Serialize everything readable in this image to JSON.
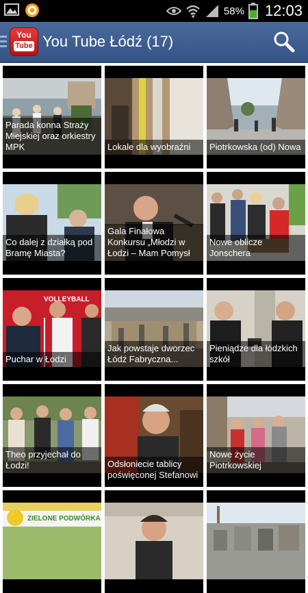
{
  "status_bar": {
    "battery_percent": "58%",
    "time": "12:03",
    "icons": [
      "image-icon",
      "app-notification-icon",
      "eye-icon",
      "wifi-icon",
      "signal-icon",
      "battery-icon"
    ]
  },
  "action_bar": {
    "app_logo_top": "You",
    "app_logo_bottom": "Tube",
    "title": "You Tube Łódź (17)",
    "search_icon": "search-icon"
  },
  "videos": [
    {
      "title": "Parada konna Straży Miejskiej oraz orkiestry MPK"
    },
    {
      "title": "Lokale dla wyobraźni"
    },
    {
      "title": "Piotrkowska (od) Nowa"
    },
    {
      "title": "Co dalej z działką pod Bramę Miasta?"
    },
    {
      "title": "Gala Finałowa Konkursu „Młodzi w Łodzi – Mam Pomysł"
    },
    {
      "title": "Nowe oblicze Jonschera"
    },
    {
      "title": "Puchar w Łodzi"
    },
    {
      "title": "Jak powstaje dworzec Łódź Fabryczna..."
    },
    {
      "title": "Pieniądze dla łódzkich szkół"
    },
    {
      "title": "Theo przyjechał do Łodzi!"
    },
    {
      "title": "Odsłoniecie tablicy poświęconej Stefanowi"
    },
    {
      "title": "Nowe życie Piotrkowskiej"
    },
    {
      "title": "",
      "thumb_text": "ZIELONE PODWÓRKA"
    },
    {
      "title": ""
    },
    {
      "title": ""
    }
  ],
  "colors": {
    "action_bar": "#3d5a8a",
    "logo_red": "#d42020"
  }
}
